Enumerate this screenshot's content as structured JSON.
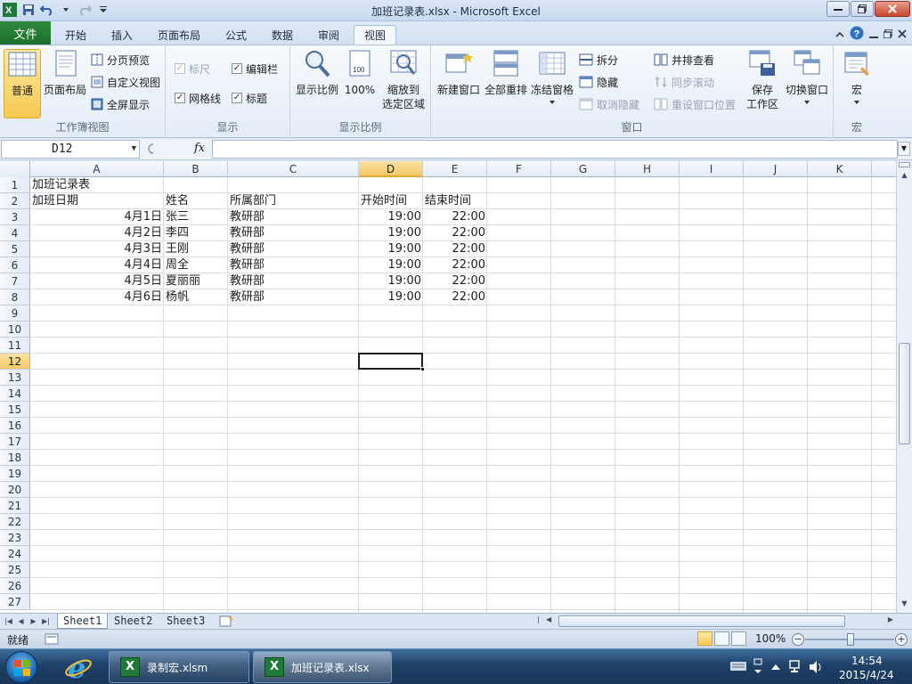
{
  "app": {
    "window_title": "加班记录表.xlsx  -  Microsoft Excel",
    "file_tab": "文件"
  },
  "tabs": [
    "开始",
    "插入",
    "页面布局",
    "公式",
    "数据",
    "审阅",
    "视图"
  ],
  "active_tab": "视图",
  "ribbon": {
    "workbook_views": {
      "label": "工作簿视图",
      "normal": "普通",
      "page_layout": "页面布局",
      "page_break_preview": "分页预览",
      "custom_views": "自定义视图",
      "full_screen": "全屏显示"
    },
    "show": {
      "label": "显示",
      "ruler": "标尺",
      "formula_bar": "编辑栏",
      "gridlines": "网格线",
      "headings": "标题"
    },
    "zoom": {
      "label": "显示比例",
      "zoom": "显示比例",
      "hundred": "100%",
      "zoom_selection_1": "缩放到",
      "zoom_selection_2": "选定区域"
    },
    "window": {
      "label": "窗口",
      "new_window": "新建窗口",
      "arrange_all": "全部重排",
      "freeze_panes": "冻结窗格",
      "split": "拆分",
      "hide": "隐藏",
      "unhide": "取消隐藏",
      "side_by_side": "并排查看",
      "sync_scroll": "同步滚动",
      "reset_position": "重设窗口位置",
      "save_workspace_1": "保存",
      "save_workspace_2": "工作区",
      "switch_windows": "切换窗口"
    },
    "macros": {
      "label": "宏",
      "macros": "宏"
    }
  },
  "formula_bar": {
    "name_box": "D12",
    "fx": "fx",
    "value": ""
  },
  "grid": {
    "columns": [
      "A",
      "B",
      "C",
      "D",
      "E",
      "F",
      "G",
      "H",
      "I",
      "J",
      "K"
    ],
    "selected_column": "D",
    "rows": [
      "1",
      "2",
      "3",
      "4",
      "5",
      "6",
      "7",
      "8",
      "9",
      "10",
      "11",
      "12",
      "13",
      "14",
      "15",
      "16",
      "17",
      "18",
      "19",
      "20",
      "21",
      "22",
      "23",
      "24",
      "25",
      "26",
      "27"
    ],
    "selected_row": "12",
    "cells": {
      "A1": "加班记录表",
      "A2": "加班日期",
      "B2": "姓名",
      "C2": "所属部门",
      "D2": "开始时间",
      "E2": "结束时间",
      "A3": "4月1日",
      "B3": "张三",
      "C3": "教研部",
      "D3": "19:00",
      "E3": "22:00",
      "A4": "4月2日",
      "B4": "李四",
      "C4": "教研部",
      "D4": "19:00",
      "E4": "22:00",
      "A5": "4月3日",
      "B5": "王刚",
      "C5": "教研部",
      "D5": "19:00",
      "E5": "22:00",
      "A6": "4月4日",
      "B6": "周全",
      "C6": "教研部",
      "D6": "19:00",
      "E6": "22:00",
      "A7": "4月5日",
      "B7": "夏丽丽",
      "C7": "教研部",
      "D7": "19:00",
      "E7": "22:00",
      "A8": "4月6日",
      "B8": "杨帆",
      "C8": "教研部",
      "D8": "19:00",
      "E8": "22:00"
    }
  },
  "sheets": [
    "Sheet1",
    "Sheet2",
    "Sheet3"
  ],
  "active_sheet": "Sheet1",
  "status": {
    "ready": "就绪",
    "zoom": "100%",
    "zoom_minus": "−",
    "zoom_plus": "+"
  },
  "taskbar": {
    "items": [
      "录制宏.xlsm",
      "加班记录表.xlsx"
    ],
    "active_item": "加班记录表.xlsx",
    "time": "14:54",
    "date": "2015/4/24"
  },
  "colors": {
    "file_tab": "#1e6f2b",
    "selection_header": "#f5c867",
    "ribbon_bg": "#e3ecf7"
  }
}
